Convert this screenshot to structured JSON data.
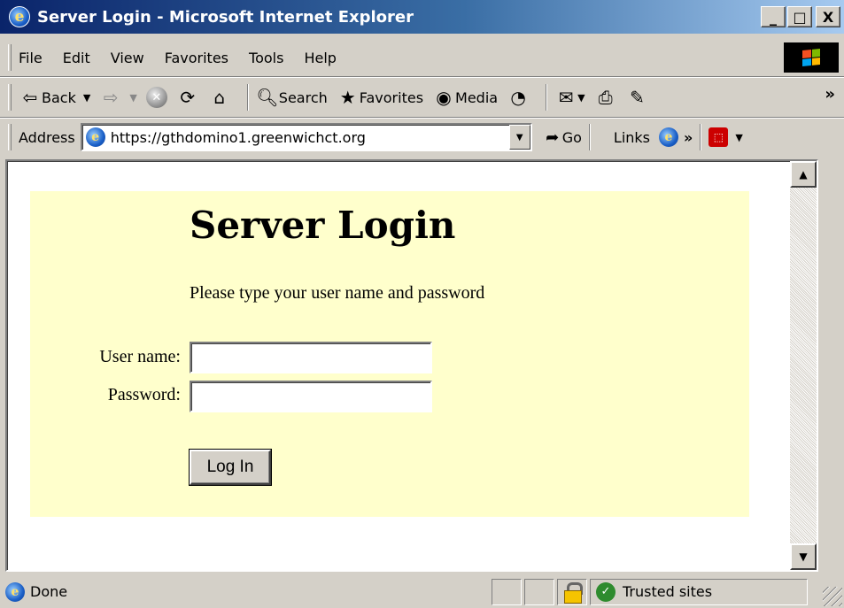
{
  "window": {
    "title": "Server Login - Microsoft Internet Explorer",
    "buttons": {
      "minimize": "_",
      "maximize": "□",
      "close": "X"
    }
  },
  "menu": [
    "File",
    "Edit",
    "View",
    "Favorites",
    "Tools",
    "Help"
  ],
  "toolbar": {
    "back_label": "Back",
    "search_label": "Search",
    "favorites_label": "Favorites",
    "media_label": "Media",
    "overflow": "»"
  },
  "address": {
    "label": "Address",
    "url": "https://gthdomino1.greenwichct.org",
    "go_label": "Go",
    "links_label": "Links",
    "links_overflow": "»"
  },
  "page": {
    "heading": "Server Login",
    "instructions": "Please type your user name and password",
    "username_label": "User name:",
    "password_label": "Password:",
    "username_value": "",
    "password_value": "",
    "login_button": "Log In"
  },
  "status": {
    "text": "Done",
    "zone": "Trusted sites"
  },
  "colors": {
    "titlebar_start": "#0a246a",
    "titlebar_end": "#a6caf0",
    "panel_bg": "#ffffcc",
    "chrome": "#d4d0c8"
  },
  "icons": [
    "ie-logo-icon",
    "back-arrow-icon",
    "forward-arrow-icon",
    "stop-icon",
    "refresh-icon",
    "home-icon",
    "search-icon",
    "favorites-icon",
    "media-icon",
    "history-icon",
    "mail-icon",
    "print-icon",
    "edit-icon",
    "go-icon",
    "pdf-icon",
    "lock-icon",
    "trusted-check-icon"
  ]
}
